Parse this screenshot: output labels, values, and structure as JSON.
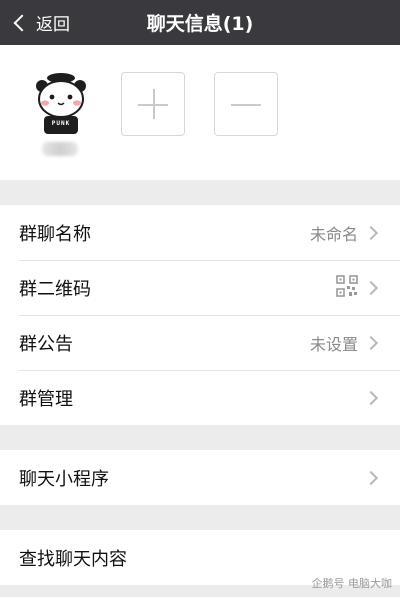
{
  "header": {
    "back_label": "返回",
    "title": "聊天信息(1)"
  },
  "members": {
    "avatar_icon": "panda-avatar-icon",
    "avatar_shirt_text": "PUNK",
    "add_icon": "plus-icon",
    "remove_icon": "minus-icon"
  },
  "settings": {
    "group_name": {
      "label": "群聊名称",
      "value": "未命名"
    },
    "group_qr": {
      "label": "群二维码",
      "icon": "qr-code-icon"
    },
    "group_notice": {
      "label": "群公告",
      "value": "未设置"
    },
    "group_manage": {
      "label": "群管理"
    }
  },
  "mini_program": {
    "label": "聊天小程序"
  },
  "search": {
    "label": "查找聊天内容"
  },
  "watermark": {
    "text": "企鹅号 电脑大咖"
  },
  "colors": {
    "header_bg": "#3a3a3e",
    "page_bg": "#ececec",
    "row_bg": "#ffffff",
    "value_text": "#8a8a8a"
  }
}
